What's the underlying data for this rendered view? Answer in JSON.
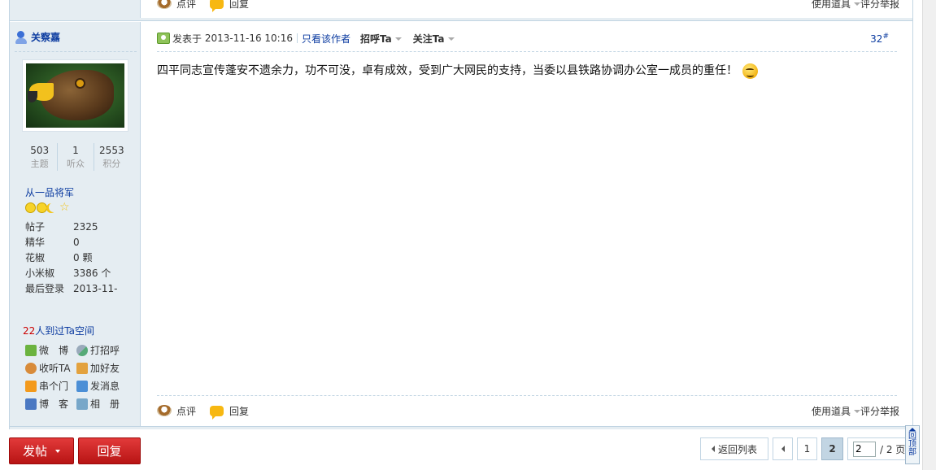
{
  "prev_post": {
    "rate_label": "点评",
    "reply_label": "回复",
    "tools_label": "使用道具",
    "score_label": "评分",
    "report_label": "举报"
  },
  "author": {
    "name": "关察嘉",
    "stats": [
      {
        "value": "503",
        "label": "主题"
      },
      {
        "value": "1",
        "label": "听众"
      },
      {
        "value": "2553",
        "label": "积分"
      }
    ],
    "rank": "从一品将军",
    "profile": [
      {
        "key": "帖子",
        "value": "2325"
      },
      {
        "key": "精华",
        "value": "0"
      },
      {
        "key": "花椒",
        "value": "0 颗"
      },
      {
        "key": "小米椒",
        "value": "3386 个"
      },
      {
        "key": "最后登录",
        "value": "2013-11-"
      }
    ],
    "visits_count": "22",
    "visits_text": "人到过Ta空间",
    "links": [
      {
        "label": "微　博",
        "icon": "weibo-icon"
      },
      {
        "label": "打招呼",
        "icon": "wave-icon"
      },
      {
        "label": "收听TA",
        "icon": "follow-icon"
      },
      {
        "label": "加好友",
        "icon": "add-friend-icon"
      },
      {
        "label": "串个门",
        "icon": "home-icon"
      },
      {
        "label": "发消息",
        "icon": "message-icon"
      },
      {
        "label": "博　客",
        "icon": "blog-icon"
      },
      {
        "label": "相　册",
        "icon": "album-icon"
      }
    ]
  },
  "post": {
    "posted_prefix": "发表于",
    "date": "2013-11-16 10:16",
    "only_author": "只看该作者",
    "hello": "招呼Ta",
    "follow": "关注Ta",
    "floor": "32",
    "floor_suffix": "#",
    "content": "四平同志宣传蓬安不遗余力，功不可没，卓有成效，受到广大网民的支持，当委以县铁路协调办公室一成员的重任！",
    "rate_label": "点评",
    "reply_label": "回复",
    "tools_label": "使用道具",
    "score_label": "评分",
    "report_label": "举报"
  },
  "bottom": {
    "post_button": "发帖",
    "reply_button": "回复",
    "back_to_list": "返回列表",
    "page1": "1",
    "current_page": "2",
    "page_input": "2",
    "total_pages": "/ 2 页",
    "back_to_top": "回顶部"
  },
  "colors": {
    "accent_blue": "#0b3ba0",
    "sidebar_bg": "#e5edf2",
    "button_red": "#c81e1e"
  }
}
